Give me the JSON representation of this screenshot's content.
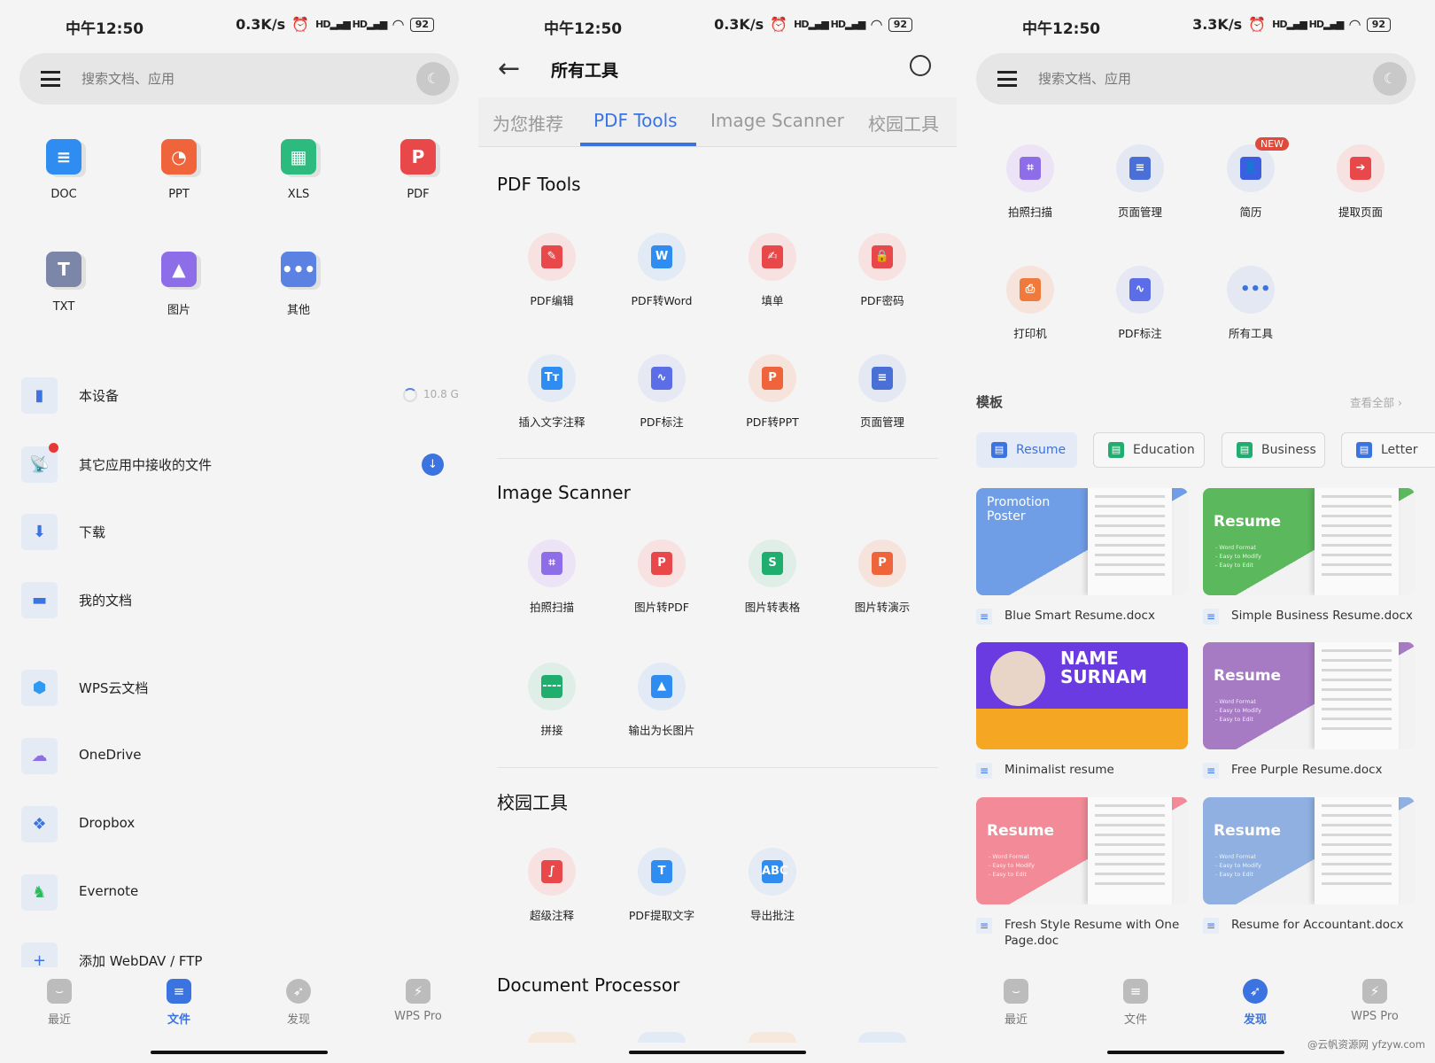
{
  "status": {
    "time": "中午12:50",
    "speed_left": "0.3K/s",
    "speed_mid": "0.3K/s",
    "speed_right": "3.3K/s",
    "signal": "HD▂▄▆ HD▂▄▆",
    "battery": "92"
  },
  "colors": {
    "accent": "#3b73e0",
    "new_badge": "#e04a3a"
  },
  "left": {
    "search_placeholder": "搜索文档、应用",
    "file_types": [
      {
        "label": "DOC",
        "icon": "doc-icon",
        "glyph": "≡",
        "color": "#2f8cf0"
      },
      {
        "label": "PPT",
        "icon": "ppt-icon",
        "glyph": "◔",
        "color": "#f0643c"
      },
      {
        "label": "XLS",
        "icon": "xls-icon",
        "glyph": "▦",
        "color": "#2dba7f"
      },
      {
        "label": "PDF",
        "icon": "pdf-icon",
        "glyph": "P",
        "color": "#e8484a"
      },
      {
        "label": "TXT",
        "icon": "txt-icon",
        "glyph": "T",
        "color": "#7c86a8"
      },
      {
        "label": "图片",
        "icon": "image-icon",
        "glyph": "▲",
        "color": "#8d6ee8"
      },
      {
        "label": "其他",
        "icon": "more-icon",
        "glyph": "•••",
        "color": "#5b82e3"
      }
    ],
    "locations": [
      {
        "label": "本设备",
        "icon": "phone-icon",
        "glyph": "▮",
        "color": "#3b73e0"
      },
      {
        "label": "其它应用中接收的文件",
        "icon": "satellite-icon",
        "glyph": "📡",
        "color": "#3b73e0"
      },
      {
        "label": "下载",
        "icon": "download-icon",
        "glyph": "⬇",
        "color": "#3b73e0"
      },
      {
        "label": "我的文档",
        "icon": "folder-icon",
        "glyph": "▬",
        "color": "#3b73e0"
      },
      {
        "label": "WPS云文档",
        "icon": "cloud-box-icon",
        "glyph": "⬢",
        "color": "#2f9af0"
      },
      {
        "label": "OneDrive",
        "icon": "onedrive-icon",
        "glyph": "☁",
        "color": "#8d6ee8"
      },
      {
        "label": "Dropbox",
        "icon": "dropbox-icon",
        "glyph": "❖",
        "color": "#3b73e0"
      },
      {
        "label": "Evernote",
        "icon": "evernote-icon",
        "glyph": "♞",
        "color": "#2dba5f"
      },
      {
        "label": "添加 WebDAV / FTP",
        "icon": "plus-icon",
        "glyph": "+",
        "color": "#3b73e0"
      }
    ],
    "storage": "10.8 G",
    "nav": [
      {
        "label": "最近",
        "icon": "recent-icon"
      },
      {
        "label": "文件",
        "icon": "files-icon",
        "active": true
      },
      {
        "label": "发现",
        "icon": "discover-icon"
      },
      {
        "label": "WPS Pro",
        "icon": "wps-pro-icon"
      }
    ]
  },
  "middle": {
    "title": "所有工具",
    "tabs": [
      "为您推荐",
      "PDF Tools",
      "Image Scanner",
      "校园工具"
    ],
    "active_tab": "PDF Tools",
    "sections": [
      {
        "title": "PDF Tools",
        "tools": [
          {
            "label": "PDF编辑",
            "icon": "pdf-edit-icon",
            "glyph": "✎",
            "color": "#e8484a",
            "bg": "#f7e1e1"
          },
          {
            "label": "PDF转Word",
            "icon": "pdf-to-word-icon",
            "glyph": "W",
            "color": "#2f8cf0",
            "bg": "#e1eaf5"
          },
          {
            "label": "填单",
            "icon": "fill-form-icon",
            "glyph": "✍",
            "color": "#e8484a",
            "bg": "#f7e1e1"
          },
          {
            "label": "PDF密码",
            "icon": "lock-icon",
            "glyph": "🔒",
            "color": "#e8484a",
            "bg": "#f7e1e1"
          },
          {
            "label": "插入文字注释",
            "icon": "text-annotation-icon",
            "glyph": "Tт",
            "color": "#2f8cf0",
            "bg": "#e4ebf4"
          },
          {
            "label": "PDF标注",
            "icon": "pdf-markup-icon",
            "glyph": "∿",
            "color": "#5b6ee8",
            "bg": "#e6e8f4"
          },
          {
            "label": "PDF转PPT",
            "icon": "pdf-to-ppt-icon",
            "glyph": "P",
            "color": "#f0643c",
            "bg": "#f6e4dc"
          },
          {
            "label": "页面管理",
            "icon": "page-manage-icon",
            "glyph": "≡",
            "color": "#4a70d8",
            "bg": "#e4e8f3"
          }
        ]
      },
      {
        "title": "Image Scanner",
        "tools": [
          {
            "label": "拍照扫描",
            "icon": "scan-icon",
            "glyph": "⌗",
            "color": "#8d6ee8",
            "bg": "#ece4f6"
          },
          {
            "label": "图片转PDF",
            "icon": "image-to-pdf-icon",
            "glyph": "P",
            "color": "#e8484a",
            "bg": "#f7e1e1"
          },
          {
            "label": "图片转表格",
            "icon": "image-to-sheet-icon",
            "glyph": "S",
            "color": "#1fae6e",
            "bg": "#dfefe7"
          },
          {
            "label": "图片转演示",
            "icon": "image-to-slides-icon",
            "glyph": "P",
            "color": "#f0643c",
            "bg": "#f6e4dc"
          },
          {
            "label": "拼接",
            "icon": "stitch-icon",
            "glyph": "----",
            "color": "#1fae6e",
            "bg": "#dfefe7"
          },
          {
            "label": "输出为长图片",
            "icon": "long-image-icon",
            "glyph": "▲",
            "color": "#2f8cf0",
            "bg": "#e1eaf5"
          }
        ]
      },
      {
        "title": "校园工具",
        "tools": [
          {
            "label": "超级注释",
            "icon": "super-annotation-icon",
            "glyph": "∫",
            "color": "#e8484a",
            "bg": "#f7e1e1"
          },
          {
            "label": "PDF提取文字",
            "icon": "extract-text-icon",
            "glyph": "T",
            "color": "#2f8cf0",
            "bg": "#e1eaf5"
          },
          {
            "label": "导出批注",
            "icon": "export-comments-icon",
            "glyph": "ABC",
            "color": "#2f8cf0",
            "bg": "#e4ebf4"
          }
        ]
      },
      {
        "title": "Document Processor",
        "tools": []
      }
    ],
    "nav": []
  },
  "right": {
    "search_placeholder": "搜索文档、应用",
    "tools": [
      {
        "label": "拍照扫描",
        "icon": "scan-icon",
        "glyph": "⌗",
        "color": "#8d6ee8",
        "bg": "#ece4f6"
      },
      {
        "label": "页面管理",
        "icon": "page-manage-icon",
        "glyph": "≡",
        "color": "#4a70d8",
        "bg": "#e4e8f3"
      },
      {
        "label": "简历",
        "icon": "resume-icon",
        "glyph": "👤",
        "color": "#3b5fe0",
        "bg": "#e4e8f3"
      },
      {
        "label": "提取页面",
        "icon": "extract-page-icon",
        "glyph": "➔",
        "color": "#e8484a",
        "bg": "#f7e1e1"
      },
      {
        "label": "打印机",
        "icon": "printer-icon",
        "glyph": "⎙",
        "color": "#f07a3c",
        "bg": "#f6e4dc"
      },
      {
        "label": "PDF标注",
        "icon": "pdf-markup-icon",
        "glyph": "∿",
        "color": "#5b6ee8",
        "bg": "#e6e8f4"
      },
      {
        "label": "所有工具",
        "icon": "all-tools-icon",
        "glyph": "•••",
        "color": "transparent",
        "bg": "#e4e8f3"
      }
    ],
    "new_badge": "NEW",
    "templates_title": "模板",
    "view_all": "查看全部",
    "chips": [
      {
        "label": "Resume",
        "color": "#3b73e0",
        "active": true
      },
      {
        "label": "Education",
        "color": "#1fae6e"
      },
      {
        "label": "Business",
        "color": "#1fae6e"
      },
      {
        "label": "Letter",
        "color": "#3b73e0"
      }
    ],
    "card_bullets": "- Word Format\n- Easy to Modify\n- Easy to Edit",
    "cards": [
      {
        "name": "Blue Smart Resume.docx",
        "thumb_title": "Promotion Poster",
        "color": "#6f9de6"
      },
      {
        "name": "Simple Business Resume.docx",
        "thumb_title": "Resume",
        "color": "#5cb85c"
      },
      {
        "name": "Minimalist resume",
        "thumb_title": "NAME SURNAM",
        "color": "#6a3be0"
      },
      {
        "name": "Free Purple Resume.docx",
        "thumb_title": "Resume",
        "color": "#a77bc4"
      },
      {
        "name": "Fresh Style Resume with One Page.doc",
        "thumb_title": "Resume",
        "color": "#f28b97"
      },
      {
        "name": "Resume for Accountant.docx",
        "thumb_title": "Resume",
        "color": "#8fb0e0"
      }
    ],
    "nav": [
      {
        "label": "最近",
        "icon": "recent-icon"
      },
      {
        "label": "文件",
        "icon": "files-icon"
      },
      {
        "label": "发现",
        "icon": "discover-icon",
        "active": true
      },
      {
        "label": "WPS Pro",
        "icon": "wps-pro-icon"
      }
    ],
    "watermark": "@云帆资源网 yfzyw.com"
  }
}
